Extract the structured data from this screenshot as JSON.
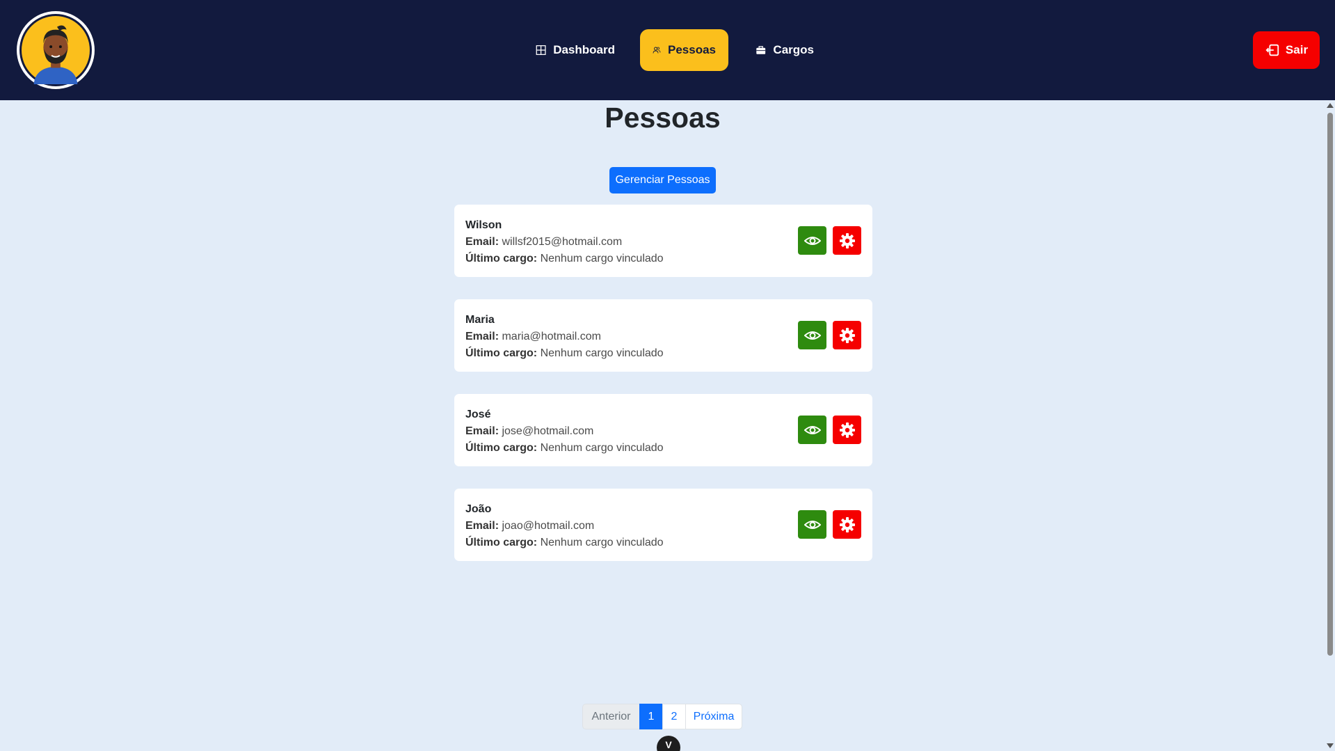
{
  "header": {
    "nav": [
      {
        "label": "Dashboard",
        "icon": "grid-icon"
      },
      {
        "label": "Pessoas",
        "icon": "people-icon"
      },
      {
        "label": "Cargos",
        "icon": "briefcase-icon"
      }
    ],
    "logout_label": "Sair",
    "active_color": "#fbbf1c",
    "background": "#121a3e"
  },
  "main": {
    "title": "Pessoas",
    "manage_button": "Gerenciar Pessoas",
    "email_label": "Email:",
    "role_label": "Último cargo:",
    "people": [
      {
        "name": "Wilson",
        "email": "willsf2015@hotmail.com",
        "role": "Nenhum cargo vinculado"
      },
      {
        "name": "Maria",
        "email": "maria@hotmail.com",
        "role": "Nenhum cargo vinculado"
      },
      {
        "name": "José",
        "email": "jose@hotmail.com",
        "role": "Nenhum cargo vinculado"
      },
      {
        "name": "João",
        "email": "joao@hotmail.com",
        "role": "Nenhum cargo vinculado"
      }
    ]
  },
  "pagination": {
    "prev": "Anterior",
    "pages": [
      "1",
      "2"
    ],
    "current": "1",
    "next": "Próxima"
  },
  "devtools_label": "V"
}
